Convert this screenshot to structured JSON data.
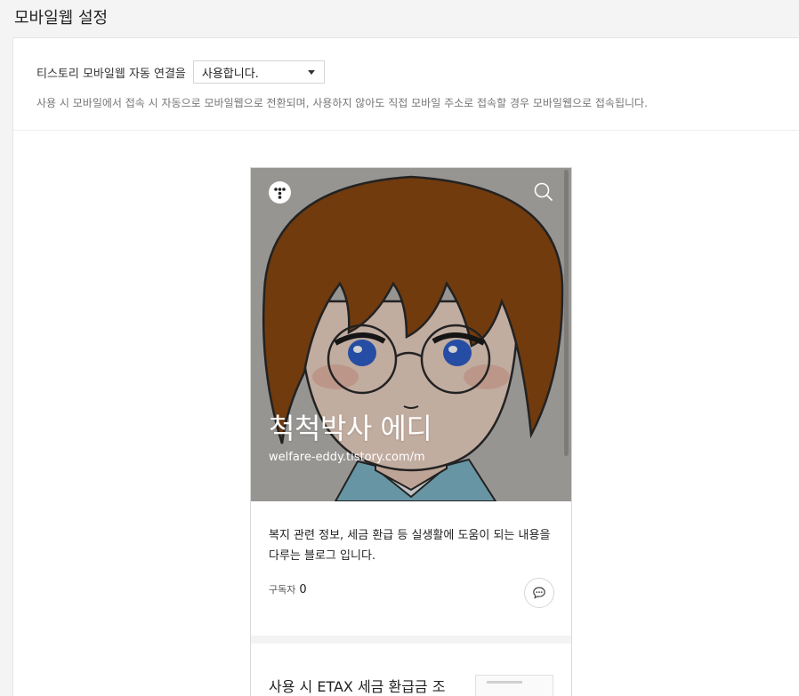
{
  "page": {
    "title": "모바일웹 설정"
  },
  "setting": {
    "label": "티스토리 모바일웹 자동 연결을",
    "selected_value": "사용합니다.",
    "description": "사용 시 모바일에서 접속 시 자동으로 모바일웹으로 전환되며, 사용하지 않아도 직접 모바일 주소로 접속할 경우 모바일웹으로 접속됩니다."
  },
  "preview": {
    "blog_title": "척척박사 에디",
    "blog_url": "welfare-eddy.tistory.com/m",
    "intro": "복지 관련 정보, 세금 환급 등 실생활에 도움이 되는 내용을 다루는 블로그 입니다.",
    "subscriber_label": "구독자",
    "subscriber_count": "0",
    "post_title": "사용 시 ETAX 세금 환급금 조"
  },
  "colors": {
    "accent": "#222222",
    "hero_bg": "#b5b3b0",
    "hair": "#8a4a10"
  },
  "icons": {
    "logo": "tistory-logo-icon",
    "search": "search-icon",
    "comment": "comment-icon",
    "dropdown": "caret-down-icon"
  }
}
